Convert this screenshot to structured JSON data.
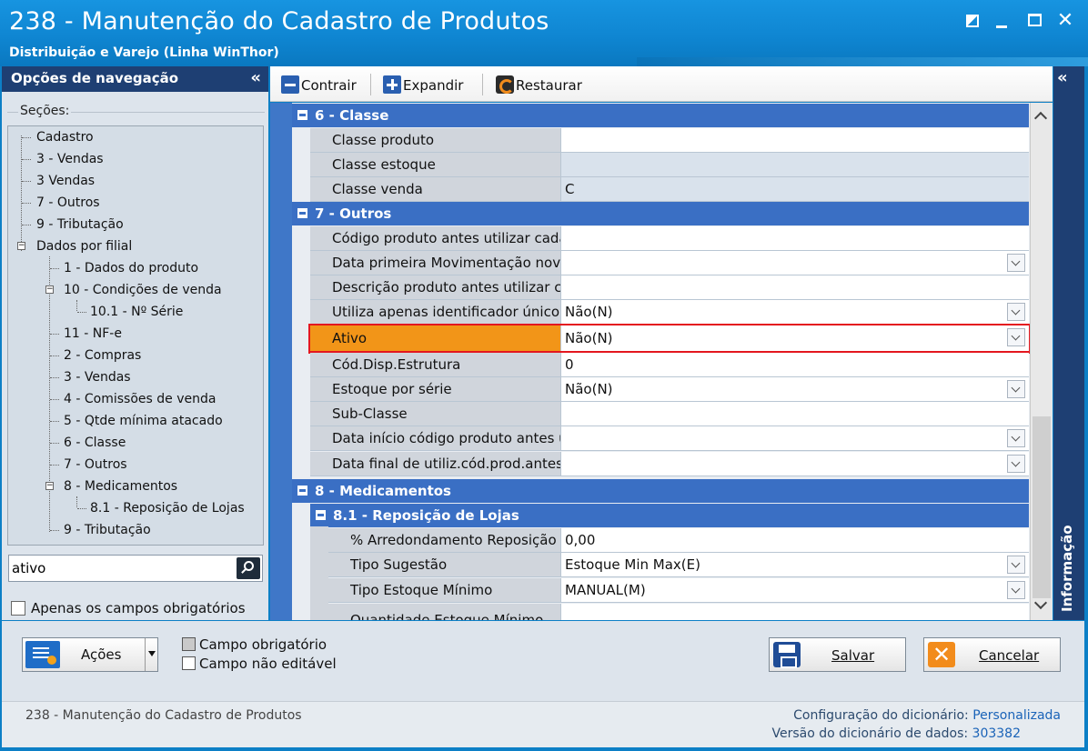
{
  "window": {
    "title": "238 - Manutenção do Cadastro de Produtos",
    "subtitle": "Distribuição e Varejo (Linha WinThor)"
  },
  "nav": {
    "header": "Opções de navegação",
    "sections_label": "Seções:",
    "tree": [
      "Cadastro",
      "3 - Vendas",
      "3 Vendas",
      "7 - Outros",
      "9 - Tributação",
      "Dados por filial",
      "1 - Dados do produto",
      "10 - Condições de venda",
      "10.1 - Nº Série",
      "11 - NF-e",
      "2 - Compras",
      "3 - Vendas",
      "4 - Comissões de venda",
      "5 - Qtde mínima atacado",
      "6 - Classe",
      "7 - Outros",
      "8 - Medicamentos",
      "8.1 -  Reposição de Lojas",
      "9 - Tributação"
    ],
    "search_value": "ativo",
    "only_required_label": "Apenas os campos obrigatórios"
  },
  "toolbar": {
    "collapse": "Contrair",
    "expand": "Expandir",
    "restore": "Restaurar"
  },
  "grid": {
    "cat6": "6 - Classe",
    "classe_produto": {
      "label": "Classe produto",
      "value": ""
    },
    "classe_estoque": {
      "label": "Classe estoque",
      "value": ""
    },
    "classe_venda": {
      "label": "Classe venda",
      "value": "C"
    },
    "cat7": "7 - Outros",
    "r1": {
      "label": "Código produto antes utilizar cada",
      "value": ""
    },
    "r2": {
      "label": "Data primeira Movimentação novo",
      "value": ""
    },
    "r3": {
      "label": "Descrição produto antes utilizar ca",
      "value": ""
    },
    "r4": {
      "label": "Utiliza apenas identificador único",
      "value": "Não(N)"
    },
    "r5": {
      "label": "Ativo",
      "value": "Não(N)"
    },
    "r6": {
      "label": "Cód.Disp.Estrutura",
      "value": "0"
    },
    "r7": {
      "label": "Estoque por série",
      "value": "Não(N)"
    },
    "r8": {
      "label": "Sub-Classe",
      "value": ""
    },
    "r9": {
      "label": "Data início código produto antes ut",
      "value": ""
    },
    "r10": {
      "label": "Data final de utiliz.cód.prod.antes",
      "value": ""
    },
    "cat8": "8 - Medicamentos",
    "cat81": "8.1 -  Reposição de Lojas",
    "s1": {
      "label": "% Arredondamento Reposição",
      "value": "0,00"
    },
    "s2": {
      "label": "Tipo Sugestão",
      "value": "Estoque Min Max(E)"
    },
    "s3": {
      "label": "Tipo Estoque Mínimo",
      "value": "MANUAL(M)"
    },
    "s4": {
      "label": "Quantidade Estoque Mínimo",
      "value": ""
    }
  },
  "info_panel": "Informação",
  "bottom": {
    "actions": "Ações",
    "legend_required": "Campo obrigatório",
    "legend_noneditable": "Campo não editável",
    "save": "Salvar",
    "cancel": "Cancelar"
  },
  "status": {
    "left": "238 - Manutenção do Cadastro de Produtos",
    "dict_config_label": "Configuração do dicionário:",
    "dict_config_value": "Personalizada",
    "dict_version_label": "Versão do dicionário de dados:",
    "dict_version_value": "303382"
  },
  "colors": {
    "titlebar": "#1794e0",
    "nav_header": "#1e3f73",
    "category": "#3a6fc4",
    "highlight_fill": "#f29518",
    "highlight_border": "#e4171f"
  }
}
